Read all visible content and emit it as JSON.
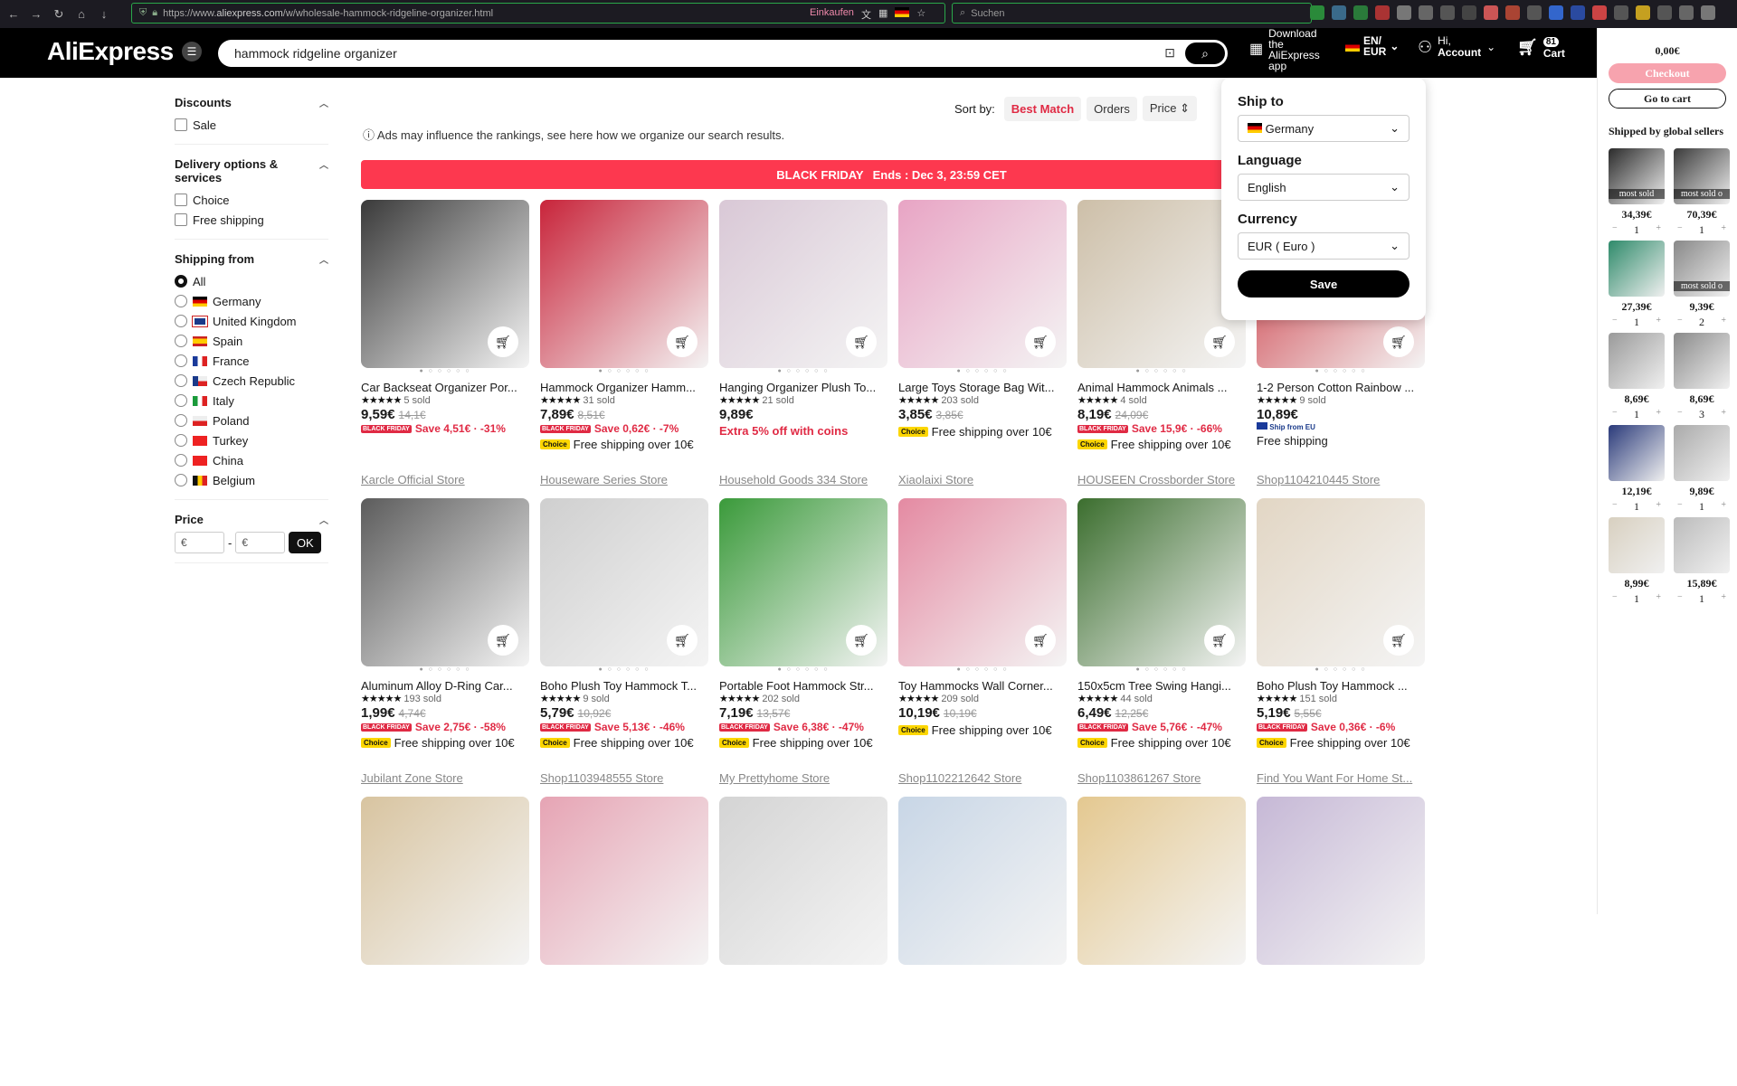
{
  "browser": {
    "url_prefix": "https://www.",
    "url_host": "aliexpress.com",
    "url_path": "/w/wholesale-hammock-ridgeline-organizer.html",
    "einkaufen": "Einkaufen",
    "search_placeholder": "Suchen"
  },
  "header": {
    "logo": "AliExpress",
    "search_value": "hammock ridgeline organizer",
    "app_download": [
      "Download",
      "the",
      "AliExpress",
      "app"
    ],
    "lang_line1": "EN/",
    "lang_line2": "EUR",
    "account_line1": "Hi,",
    "account_line2": "Account",
    "cart_count": "81",
    "cart_label": "Cart"
  },
  "filters": {
    "discounts": {
      "title": "Discounts",
      "options": [
        "Sale"
      ]
    },
    "delivery": {
      "title": "Delivery options & services",
      "options": [
        "Choice",
        "Free shipping"
      ]
    },
    "shipping_from": {
      "title": "Shipping from",
      "options": [
        "All",
        "Germany",
        "United Kingdom",
        "Spain",
        "France",
        "Czech Republic",
        "Italy",
        "Poland",
        "Turkey",
        "China",
        "Belgium"
      ]
    },
    "price": {
      "title": "Price",
      "min_placeholder": "€",
      "max_placeholder": "€",
      "sep": "-",
      "ok": "OK"
    }
  },
  "sort": {
    "label": "Sort by:",
    "best_match": "Best Match",
    "orders": "Orders",
    "price": "Price"
  },
  "ads_note": "Ads may influence the rankings, see here how we organize our search results.",
  "banner": {
    "title": "BLACK FRIDAY",
    "ends": "Ends : Dec 3, 23:59 CET"
  },
  "products": [
    {
      "title": "Car Backseat Organizer Por...",
      "sold": "5 sold",
      "price": "9,59€",
      "old": "14,1€",
      "save": "Save 4,51€ · -31%",
      "ship": "",
      "store": "Karcle Official Store",
      "color": "#3a3a3a"
    },
    {
      "title": "Hammock Organizer Hamm...",
      "sold": "31 sold",
      "price": "7,89€",
      "old": "8,51€",
      "save": "Save 0,62€ · -7%",
      "ship": "Free shipping over 10€",
      "store": "Houseware Series Store",
      "color": "#c8243a"
    },
    {
      "title": "Hanging Organizer Plush To...",
      "sold": "21 sold",
      "price": "9,89€",
      "old": "",
      "save": "",
      "extra": "Extra 5% off with coins",
      "ship": "",
      "store": "Household Goods 334 Store",
      "color": "#d9c8d6"
    },
    {
      "title": "Large Toys Storage Bag Wit...",
      "sold": "203 sold",
      "price": "3,85€",
      "old": "3,85€",
      "save": "",
      "ship": "Free shipping over 10€",
      "store": "Xiaolaixi Store",
      "color": "#e8a4c4"
    },
    {
      "title": "Animal Hammock Animals ...",
      "sold": "4 sold",
      "price": "8,19€",
      "old": "24,09€",
      "save": "Save 15,9€ · -66%",
      "ship": "Free shipping over 10€",
      "store": "HOUSEEN Crossborder Store",
      "color": "#cdbfa8"
    },
    {
      "title": "1-2 Person Cotton Rainbow ...",
      "sold": "9 sold",
      "price": "10,89€",
      "old": "",
      "save": "",
      "ship_eu": "Ship from EU",
      "ship": "Free shipping",
      "store": "Shop1104210445 Store",
      "color": "#c9303a"
    },
    {
      "title": "Aluminum Alloy D-Ring Car...",
      "sold": "193 sold",
      "price": "1,99€",
      "old": "4,74€",
      "save": "Save 2,75€ · -58%",
      "ship": "Free shipping over 10€",
      "store": "Jubilant Zone Store",
      "color": "#5c5c5c"
    },
    {
      "title": "Boho Plush Toy Hammock T...",
      "sold": "9 sold",
      "price": "5,79€",
      "old": "10,92€",
      "save": "Save 5,13€ · -46%",
      "ship": "Free shipping over 10€",
      "store": "Shop1103948555 Store",
      "color": "#cfcfcf"
    },
    {
      "title": "Portable Foot Hammock Str...",
      "sold": "202 sold",
      "price": "7,19€",
      "old": "13,57€",
      "save": "Save 6,38€ · -47%",
      "ship": "Free shipping over 10€",
      "store": "My Prettyhome Store",
      "color": "#3a9a3a"
    },
    {
      "title": "Toy Hammocks Wall Corner...",
      "sold": "209 sold",
      "price": "10,19€",
      "old": "10,19€",
      "save": "",
      "ship": "Free shipping over 10€",
      "store": "Shop1102212642 Store",
      "color": "#e48aa2"
    },
    {
      "title": "150x5cm Tree Swing Hangi...",
      "sold": "44 sold",
      "price": "6,49€",
      "old": "12,25€",
      "save": "Save 5,76€ · -47%",
      "ship": "Free shipping over 10€",
      "store": "Shop1103861267 Store",
      "color": "#3b6e2e"
    },
    {
      "title": "Boho Plush Toy Hammock ...",
      "sold": "151 sold",
      "price": "5,19€",
      "old": "5,55€",
      "save": "Save 0,36€ · -6%",
      "ship": "Free shipping over 10€",
      "store": "Find You Want For Home St...",
      "color": "#e2d6c4"
    },
    {
      "color": "#d8c4a0"
    },
    {
      "color": "#e6a4b4"
    },
    {
      "color": "#d4d4d4"
    },
    {
      "color": "#c8d6e6"
    },
    {
      "color": "#e4c890"
    },
    {
      "color": "#c6b8d6"
    }
  ],
  "ship_popup": {
    "ship_to_label": "Ship to",
    "ship_to_value": "Germany",
    "language_label": "Language",
    "language_value": "English",
    "currency_label": "Currency",
    "currency_value": "EUR ( Euro )",
    "save": "Save"
  },
  "right_panel": {
    "total": "0,00€",
    "checkout": "Checkout",
    "go_to_cart": "Go to cart",
    "heading": "Shipped by global sellers",
    "items": [
      {
        "price": "34,39€",
        "qty": "1",
        "sold": "most sold",
        "color": "#2b2b2b"
      },
      {
        "price": "70,39€",
        "qty": "1",
        "sold": "most sold o",
        "color": "#3a3a3a"
      },
      {
        "price": "27,39€",
        "qty": "1",
        "sold": "",
        "color": "#2e8a6a"
      },
      {
        "price": "9,39€",
        "qty": "2",
        "sold": "most sold o",
        "color": "#888"
      },
      {
        "price": "8,69€",
        "qty": "1",
        "sold": "",
        "color": "#9a9a9a"
      },
      {
        "price": "8,69€",
        "qty": "3",
        "sold": "",
        "color": "#8a8a8a"
      },
      {
        "price": "12,19€",
        "qty": "1",
        "sold": "",
        "color": "#2a3a7a"
      },
      {
        "price": "9,89€",
        "qty": "1",
        "sold": "",
        "color": "#aaa"
      },
      {
        "price": "8,99€",
        "qty": "1",
        "sold": "",
        "color": "#d8d0c0"
      },
      {
        "price": "15,89€",
        "qty": "1",
        "sold": "",
        "color": "#bbb"
      }
    ]
  }
}
